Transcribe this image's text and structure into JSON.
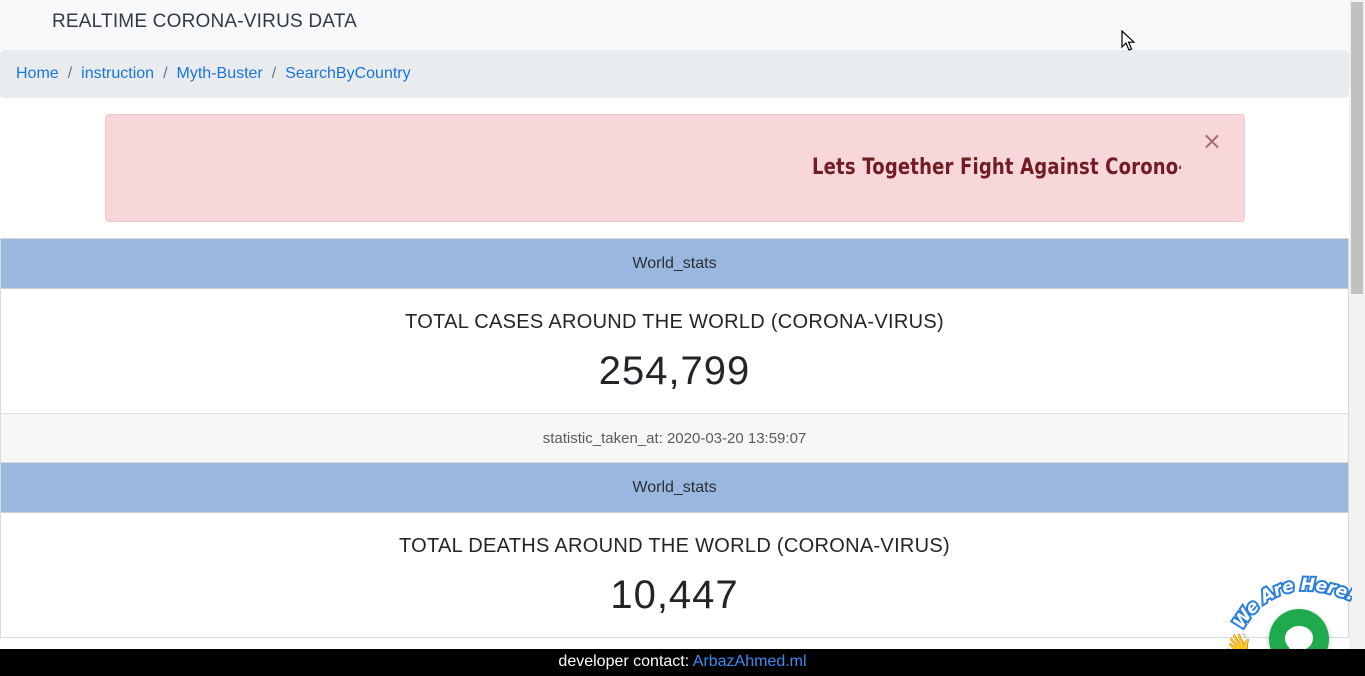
{
  "navbar": {
    "brand": "REALTIME CORONA-VIRUS DATA"
  },
  "breadcrumb": {
    "items": [
      {
        "label": "Home"
      },
      {
        "label": "instruction"
      },
      {
        "label": "Myth-Buster"
      },
      {
        "label": "SearchByCountry"
      }
    ],
    "separator": "/"
  },
  "alert": {
    "message": "Lets Together Fight Against Corono-Vi",
    "close_symbol": "×"
  },
  "stats": [
    {
      "header": "World_stats",
      "title": "TOTAL CASES AROUND THE WORLD (CORONA-VIRUS)",
      "value": "254,799",
      "footer": "statistic_taken_at: 2020-03-20 13:59:07"
    },
    {
      "header": "World_stats",
      "title": "TOTAL DEATHS AROUND THE WORLD (CORONA-VIRUS)",
      "value": "10,447"
    }
  ],
  "footer_bar": {
    "prefix": "developer contact:",
    "link": "ArbazAhmed.ml"
  },
  "chat_widget": {
    "badge_text": "We Are Here!",
    "icons": [
      "chat-bubble-icon",
      "waving-hand-icon"
    ],
    "color": "#1faa4e"
  },
  "colors": {
    "card_header": "#9ab7df",
    "alert_bg": "#f8d7da",
    "alert_text": "#721c24",
    "link": "#1a73d9"
  }
}
